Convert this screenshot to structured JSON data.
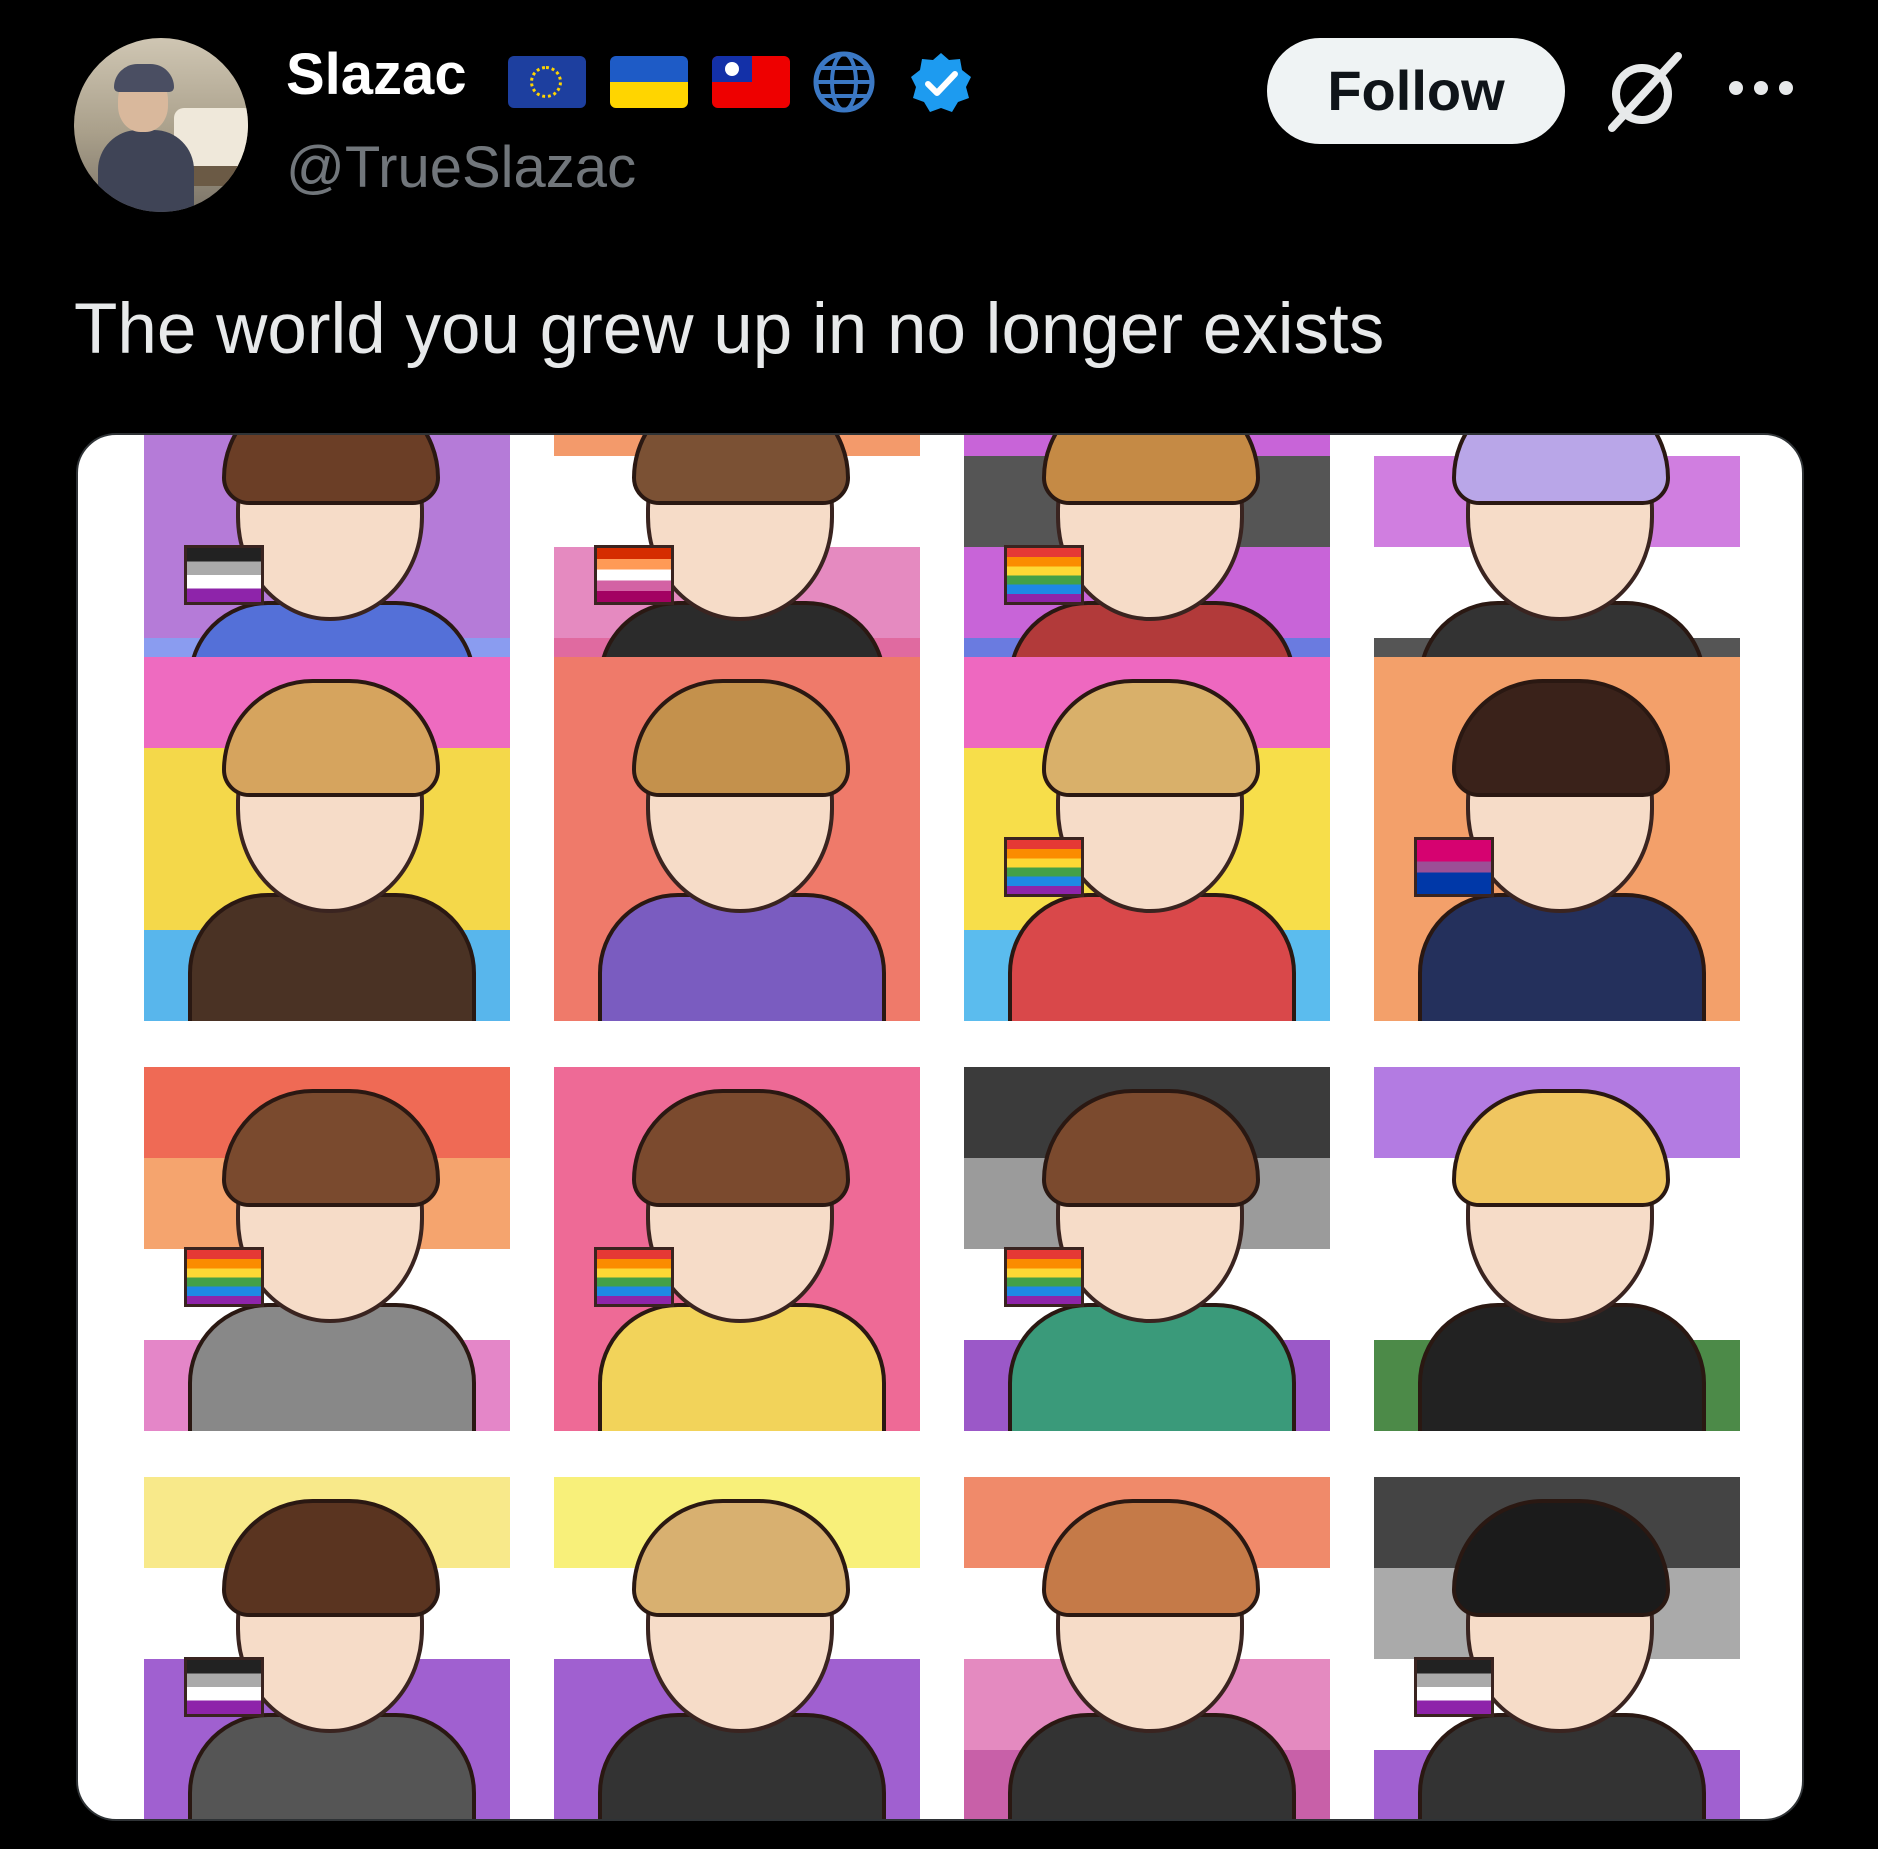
{
  "header": {
    "display_name": "Slazac",
    "handle": "@TrueSlazac",
    "badges": [
      "eu-flag-icon",
      "ukraine-flag-icon",
      "taiwan-flag-icon",
      "globe-icon",
      "verified-badge-icon"
    ],
    "follow_label": "Follow",
    "colors": {
      "verified": "#1d9bf0",
      "handle": "#71767b",
      "follow_bg": "#eff3f4"
    }
  },
  "tweet": {
    "text": "The world you grew up in no longer exists"
  },
  "media": {
    "cards": [
      {
        "stripes": [
          "#b57bd8",
          "#b57bd8",
          "#b57bd8",
          "#8a9cf0"
        ],
        "hair": "#6b3e26",
        "body": "#5470d8",
        "flag": "asexual"
      },
      {
        "stripes": [
          "#f39a6b",
          "#ffffff",
          "#e58ac0",
          "#e06aa0"
        ],
        "hair": "#7b5134",
        "body": "#2b2b2b",
        "flag": "lesbian"
      },
      {
        "stripes": [
          "#c864d8",
          "#555555",
          "#c864d8",
          "#6a7be0"
        ],
        "hair": "#c58a45",
        "body": "#b23a3a",
        "flag": "rainbow"
      },
      {
        "stripes": [
          "#ffffff",
          "#d07ee0",
          "#ffffff",
          "#555555"
        ],
        "hair": "#b9a6e8",
        "body": "#333333",
        "flag": "none"
      },
      {
        "stripes": [
          "#ee6bc0",
          "#f4d84a",
          "#f4d84a",
          "#58b6ec"
        ],
        "hair": "#d6a45e",
        "body": "#4a3224",
        "flag": "none"
      },
      {
        "stripes": [
          "#ef7a6a",
          "#ef7a6a",
          "#ef7a6a",
          "#ef7a6a"
        ],
        "hair": "#c4914c",
        "body": "#7a5cc0",
        "flag": "none"
      },
      {
        "stripes": [
          "#ee68c0",
          "#f7de4a",
          "#f7de4a",
          "#5bbcee"
        ],
        "hair": "#d9b06a",
        "body": "#d9484a",
        "flag": "rainbow"
      },
      {
        "stripes": [
          "#f3a06a",
          "#f3a06a",
          "#f3a06a",
          "#f3a06a"
        ],
        "hair": "#3a221a",
        "body": "#24305c",
        "flag": "bisexual"
      },
      {
        "stripes": [
          "#ef6a55",
          "#f5a46e",
          "#ffffff",
          "#e486c8"
        ],
        "hair": "#7a4a2e",
        "body": "#888888",
        "flag": "rainbow"
      },
      {
        "stripes": [
          "#ee6a96",
          "#ee6a96",
          "#ee6a96",
          "#ee6a96"
        ],
        "hair": "#7b4a2e",
        "body": "#f2d35a",
        "flag": "rainbow"
      },
      {
        "stripes": [
          "#3b3b3b",
          "#9b9b9b",
          "#ffffff",
          "#9b58c8"
        ],
        "hair": "#7b4a2e",
        "body": "#3a9a7a",
        "flag": "rainbow"
      },
      {
        "stripes": [
          "#b37be2",
          "#ffffff",
          "#ffffff",
          "#4c8a48"
        ],
        "hair": "#f0c660",
        "body": "#222222",
        "flag": "none"
      },
      {
        "stripes": [
          "#f8e98a",
          "#ffffff",
          "#a060d0",
          "#a060d0"
        ],
        "hair": "#5a3420",
        "body": "#555555",
        "flag": "asexual"
      },
      {
        "stripes": [
          "#f8f07a",
          "#ffffff",
          "#a060d0",
          "#a060d0"
        ],
        "hair": "#d8b070",
        "body": "#333333",
        "flag": "none"
      },
      {
        "stripes": [
          "#f08a6a",
          "#ffffff",
          "#e48ac0",
          "#c860a8"
        ],
        "hair": "#c57a48",
        "body": "#333333",
        "flag": "none"
      },
      {
        "stripes": [
          "#444444",
          "#aaaaaa",
          "#ffffff",
          "#a060d0"
        ],
        "hair": "#1b1b1b",
        "body": "#333333",
        "flag": "asexual"
      }
    ]
  }
}
